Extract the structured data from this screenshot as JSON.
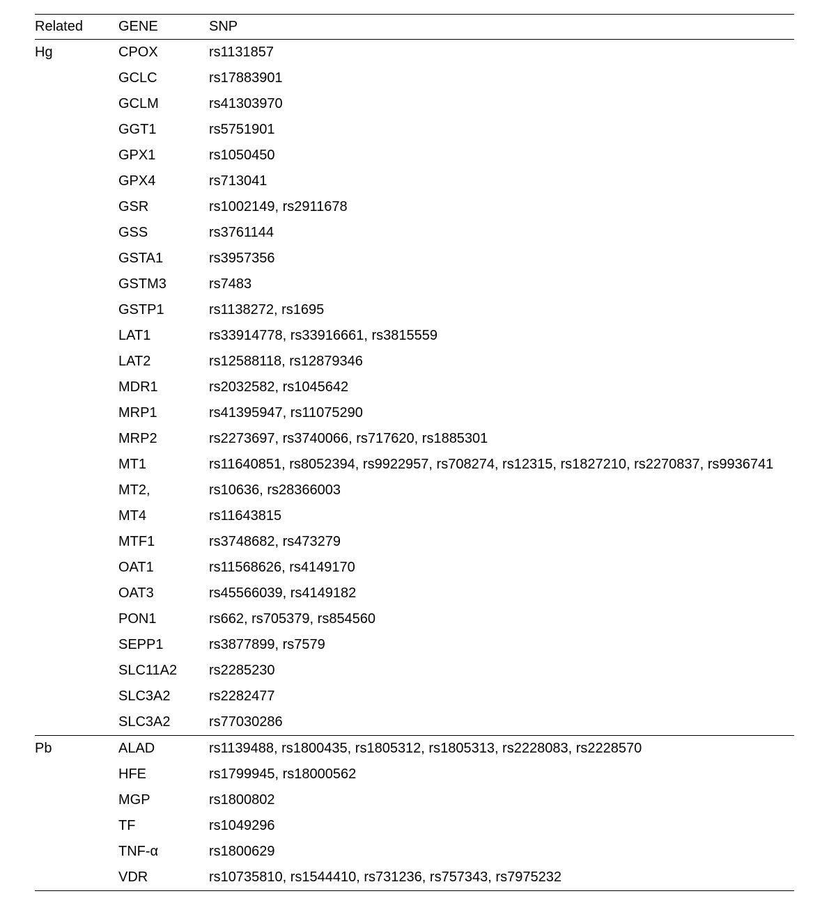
{
  "headers": {
    "related": "Related",
    "gene": "GENE",
    "snp": "SNP"
  },
  "groups": [
    {
      "related": "Hg",
      "rows": [
        {
          "gene": "CPOX",
          "snp": "rs1131857"
        },
        {
          "gene": "GCLC",
          "snp": "rs17883901"
        },
        {
          "gene": "GCLM",
          "snp": "rs41303970"
        },
        {
          "gene": "GGT1",
          "snp": "rs5751901"
        },
        {
          "gene": "GPX1",
          "snp": "rs1050450"
        },
        {
          "gene": "GPX4",
          "snp": "rs713041"
        },
        {
          "gene": "GSR",
          "snp": "rs1002149, rs2911678"
        },
        {
          "gene": "GSS",
          "snp": "rs3761144"
        },
        {
          "gene": "GSTA1",
          "snp": "rs3957356"
        },
        {
          "gene": "GSTM3",
          "snp": "rs7483"
        },
        {
          "gene": "GSTP1",
          "snp": "rs1138272, rs1695"
        },
        {
          "gene": "LAT1",
          "snp": "rs33914778, rs33916661, rs3815559"
        },
        {
          "gene": "LAT2",
          "snp": "rs12588118, rs12879346"
        },
        {
          "gene": "MDR1",
          "snp": "rs2032582, rs1045642"
        },
        {
          "gene": "MRP1",
          "snp": "rs41395947, rs11075290"
        },
        {
          "gene": "MRP2",
          "snp": "rs2273697, rs3740066, rs717620, rs1885301"
        },
        {
          "gene": "MT1",
          "snp": "rs11640851, rs8052394, rs9922957, rs708274, rs12315, rs1827210, rs2270837, rs9936741"
        },
        {
          "gene": "MT2,",
          "snp": "rs10636, rs28366003"
        },
        {
          "gene": "MT4",
          "snp": "rs11643815"
        },
        {
          "gene": "MTF1",
          "snp": "rs3748682, rs473279"
        },
        {
          "gene": "OAT1",
          "snp": "rs11568626, rs4149170"
        },
        {
          "gene": "OAT3",
          "snp": "rs45566039, rs4149182"
        },
        {
          "gene": "PON1",
          "snp": "rs662, rs705379, rs854560"
        },
        {
          "gene": "SEPP1",
          "snp": "rs3877899, rs7579"
        },
        {
          "gene": "SLC11A2",
          "snp": "rs2285230"
        },
        {
          "gene": "SLC3A2",
          "snp": "rs2282477"
        },
        {
          "gene": "SLC3A2",
          "snp": "rs77030286"
        }
      ]
    },
    {
      "related": "Pb",
      "rows": [
        {
          "gene": "ALAD",
          "snp": "rs1139488, rs1800435, rs1805312, rs1805313, rs2228083, rs2228570"
        },
        {
          "gene": "HFE",
          "snp": "rs1799945, rs18000562"
        },
        {
          "gene": "MGP",
          "snp": "rs1800802"
        },
        {
          "gene": "TF",
          "snp": "rs1049296"
        },
        {
          "gene": "TNF-α",
          "snp": "rs1800629"
        },
        {
          "gene": "VDR",
          "snp": "rs10735810, rs1544410, rs731236, rs757343, rs7975232"
        }
      ]
    }
  ]
}
